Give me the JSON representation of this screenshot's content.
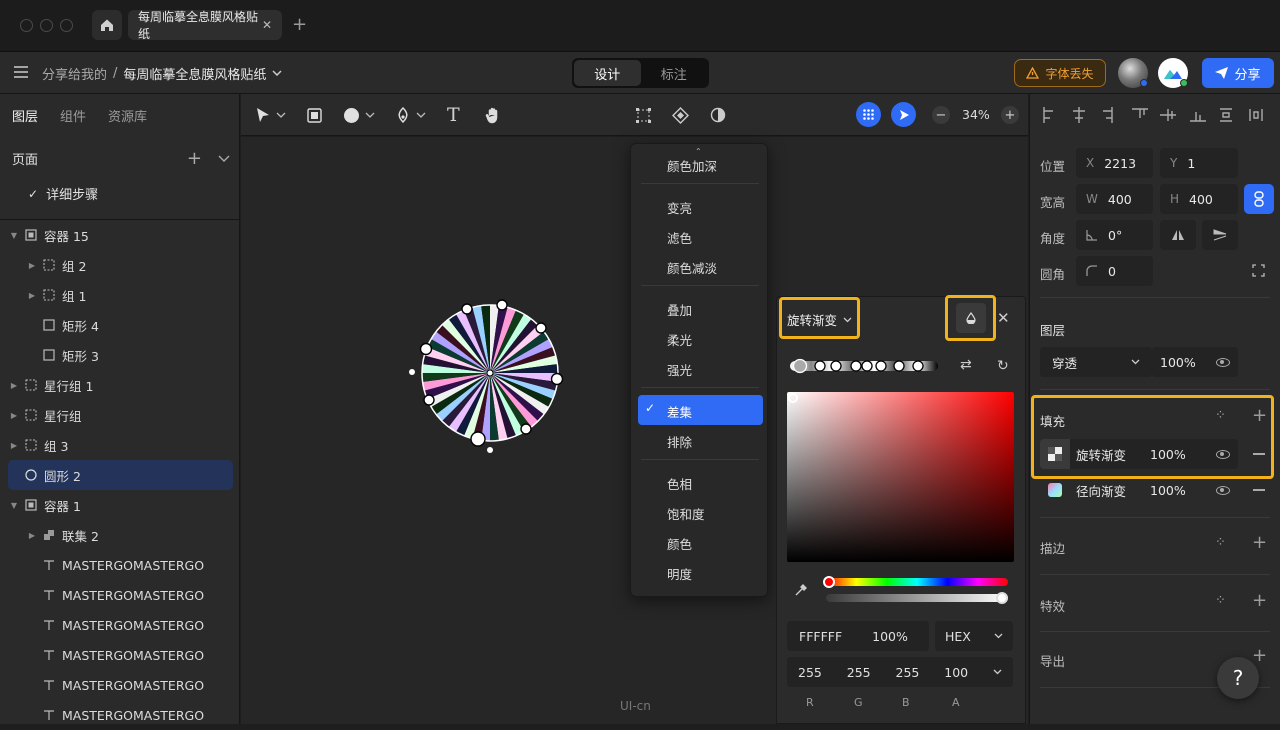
{
  "window": {
    "tab_title": "每周临摹全息膜风格贴纸"
  },
  "header": {
    "breadcrumb_parent": "分享给我的",
    "breadcrumb_sep": "/",
    "breadcrumb_doc": "每周临摹全息膜风格贴纸",
    "mode_tabs": [
      "设计",
      "标注"
    ],
    "font_warning": "字体丢失",
    "share_label": "分享"
  },
  "left": {
    "tabs": [
      "图层",
      "组件",
      "资源库"
    ],
    "pages_title": "页面",
    "page_item": "详细步骤",
    "layers": [
      {
        "name": "容器 15",
        "icon": "frame",
        "indent": 0,
        "caret": "down"
      },
      {
        "name": "组 2",
        "icon": "group",
        "indent": 1,
        "caret": "right"
      },
      {
        "name": "组 1",
        "icon": "group",
        "indent": 1,
        "caret": "right"
      },
      {
        "name": "矩形 4",
        "icon": "rect",
        "indent": 1,
        "caret": ""
      },
      {
        "name": "矩形 3",
        "icon": "rect",
        "indent": 1,
        "caret": ""
      },
      {
        "name": "星行组 1",
        "icon": "group",
        "indent": 0,
        "caret": "right"
      },
      {
        "name": "星行组",
        "icon": "group",
        "indent": 0,
        "caret": "right"
      },
      {
        "name": "组 3",
        "icon": "group",
        "indent": 0,
        "caret": "right"
      },
      {
        "name": "圆形 2",
        "icon": "ellipse",
        "indent": 0,
        "caret": "",
        "selected": true
      },
      {
        "name": "容器 1",
        "icon": "frame",
        "indent": 0,
        "caret": "down"
      },
      {
        "name": "联集 2",
        "icon": "union",
        "indent": 1,
        "caret": "right"
      },
      {
        "name": "MASTERGOMASTERGO",
        "icon": "text",
        "indent": 1,
        "caret": ""
      },
      {
        "name": "MASTERGOMASTERGO",
        "icon": "text",
        "indent": 1,
        "caret": ""
      },
      {
        "name": "MASTERGOMASTERGO",
        "icon": "text",
        "indent": 1,
        "caret": ""
      },
      {
        "name": "MASTERGOMASTERGO",
        "icon": "text",
        "indent": 1,
        "caret": ""
      },
      {
        "name": "MASTERGOMASTERGO",
        "icon": "text",
        "indent": 1,
        "caret": ""
      },
      {
        "name": "MASTERGOMASTERGO",
        "icon": "text",
        "indent": 1,
        "caret": ""
      }
    ]
  },
  "toolbar": {
    "zoom": "34%"
  },
  "blend_menu": {
    "items_top": [
      "颜色加深"
    ],
    "group1": [
      "变亮",
      "滤色",
      "颜色减淡"
    ],
    "group2": [
      "叠加",
      "柔光",
      "强光"
    ],
    "group3": [
      "差集",
      "排除"
    ],
    "group4": [
      "色相",
      "饱和度",
      "颜色",
      "明度"
    ],
    "selected": "差集"
  },
  "picker": {
    "gradient_type": "旋转渐变",
    "hex": "FFFFFF",
    "opacity": "100%",
    "format": "HEX",
    "r": "255",
    "g": "255",
    "b": "255",
    "a": "100",
    "labels": [
      "R",
      "G",
      "B",
      "A"
    ]
  },
  "right": {
    "position_label": "位置",
    "x_key": "X",
    "x": "2213",
    "y_key": "Y",
    "y": "1",
    "size_label": "宽高",
    "w_key": "W",
    "w": "400",
    "h_key": "H",
    "h": "400",
    "angle_label": "角度",
    "angle": "0°",
    "radius_label": "圆角",
    "radius": "0",
    "layer_label": "图层",
    "blend": "穿透",
    "layer_opacity": "100%",
    "fill_label": "填充",
    "fills": [
      {
        "name": "旋转渐变",
        "opacity": "100%"
      },
      {
        "name": "径向渐变",
        "opacity": "100%"
      }
    ],
    "stroke_label": "描边",
    "effect_label": "特效",
    "export_label": "导出"
  },
  "help": "?",
  "watermark": "UI-cn",
  "colors": {
    "accent": "#2f6bf5",
    "highlight": "#f2b31a",
    "warning": "#f0a030"
  }
}
